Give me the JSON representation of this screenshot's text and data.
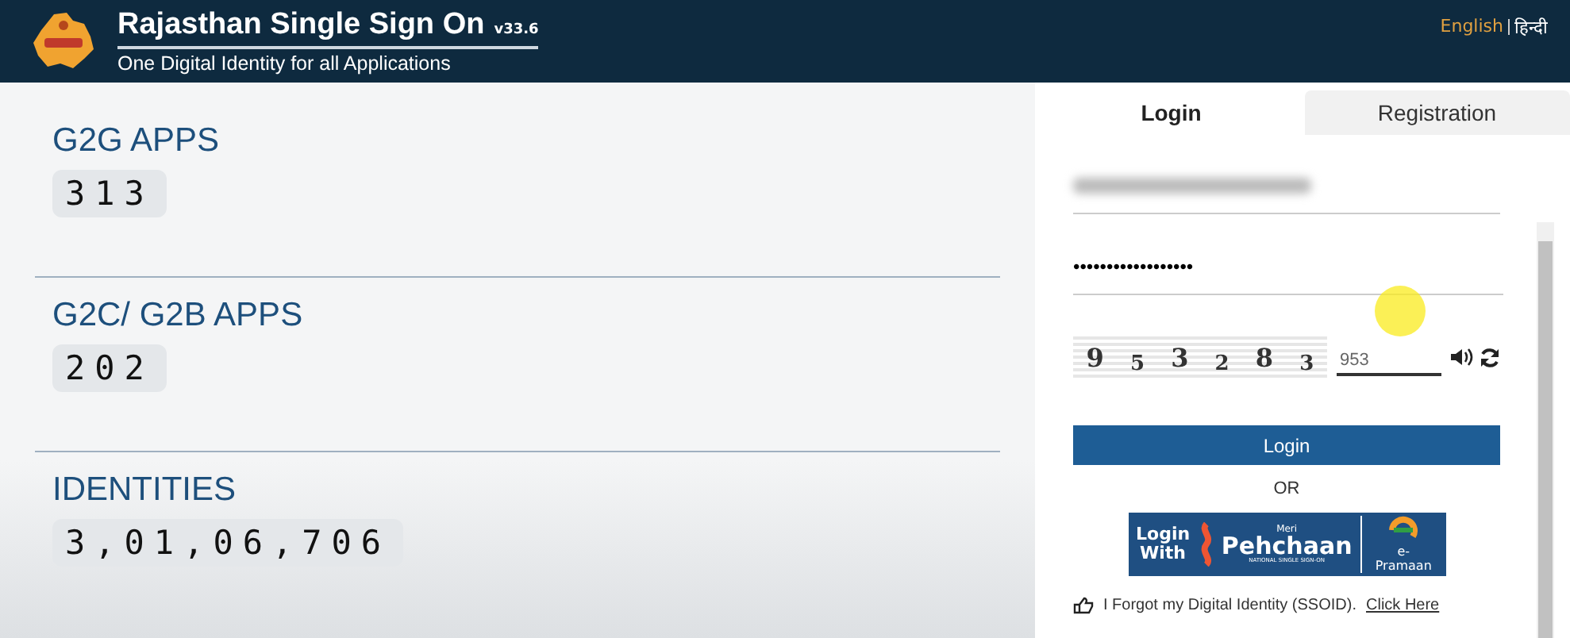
{
  "header": {
    "title": "Rajasthan Single Sign On",
    "version": "v33.6",
    "subtitle": "One Digital Identity for all Applications",
    "languages": [
      {
        "label": "English",
        "selected": true
      },
      {
        "label": "हिन्दी",
        "selected": false
      }
    ]
  },
  "stats": [
    {
      "label": "G2G APPS",
      "count": "313"
    },
    {
      "label": "G2C/ G2B APPS",
      "count": "202"
    },
    {
      "label": "IDENTITIES",
      "count": "3,01,06,706"
    }
  ],
  "tabs": [
    {
      "label": "Login",
      "selected": true
    },
    {
      "label": "Registration",
      "selected": false
    }
  ],
  "login": {
    "password": "••••••••••••••••••",
    "captcha": [
      "9",
      "5",
      "3",
      "2",
      "8",
      "3"
    ],
    "captcha_value": "953",
    "button": "Login",
    "or": "OR",
    "badge": {
      "login_with": [
        "Login",
        "With"
      ],
      "meri": "Meri",
      "name": "Pehchaan",
      "tagline": "NATIONAL SINGLE SIGN-ON",
      "partner": "e-Pramaan"
    },
    "forgot": "I Forgot my Digital Identity (SSOID).",
    "forgot_link": "Click Here"
  }
}
